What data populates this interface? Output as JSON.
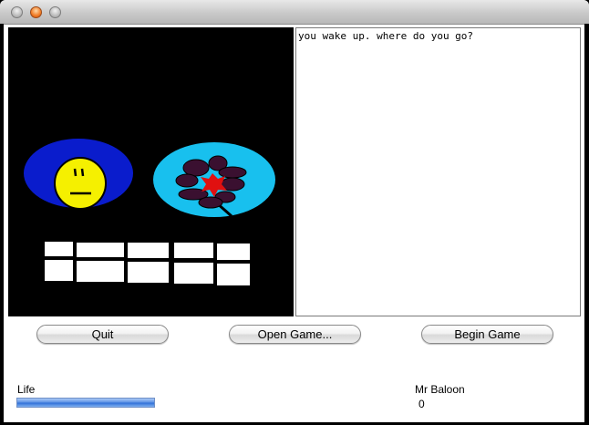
{
  "window": {
    "title": ""
  },
  "story": {
    "text": "you wake up. where do you go?"
  },
  "buttons": {
    "quit": "Quit",
    "open_game": "Open Game...",
    "begin_game": "Begin Game"
  },
  "status": {
    "life_label": "Life",
    "life_fraction": 1.0,
    "enemy_name": "Mr Baloon",
    "enemy_value": "0"
  },
  "icons": {
    "close": "close-window-icon",
    "minimize": "minimize-window-icon",
    "zoom": "zoom-window-icon"
  },
  "colors": {
    "canvas_bg": "#000000",
    "face_oval": "#0a1ccc",
    "face": "#f5f000",
    "flower_oval": "#18c0ee",
    "flower_center": "#e01010",
    "petals": "#3a1030",
    "life_bar": "#3f7ce0"
  }
}
